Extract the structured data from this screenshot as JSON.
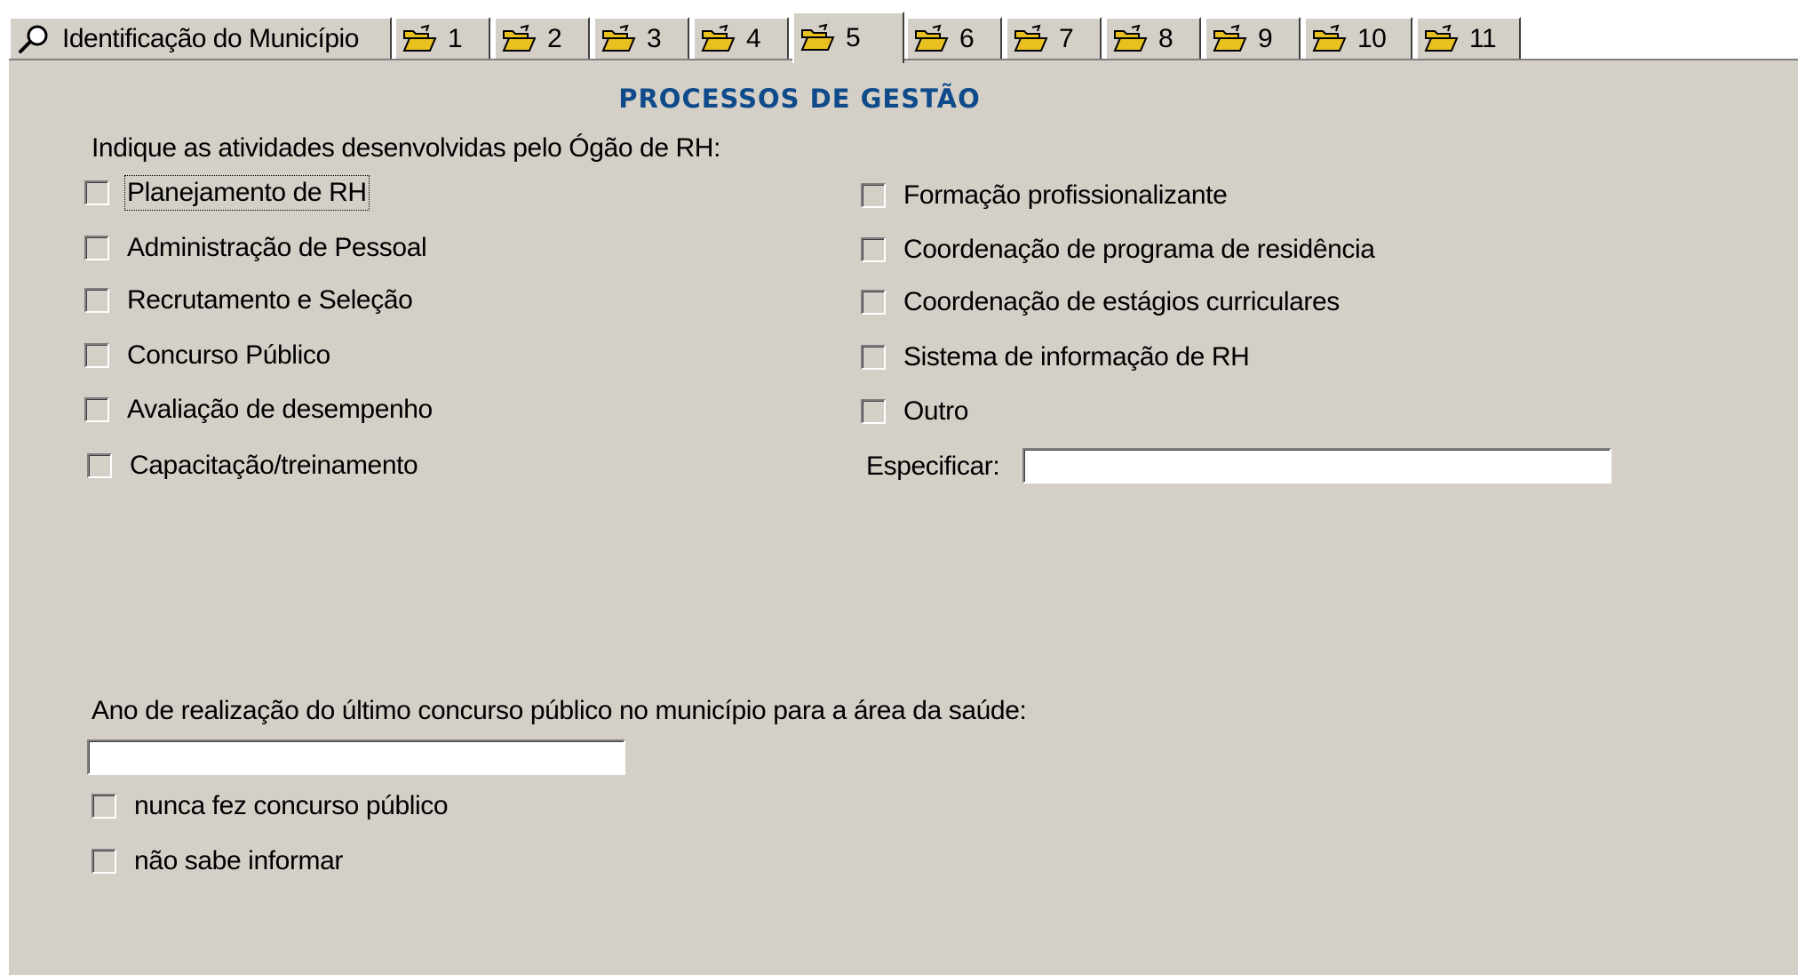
{
  "tabs": [
    {
      "label": "Identificação do Município",
      "icon": "search-icon"
    },
    {
      "label": "1",
      "icon": "open-folder-icon"
    },
    {
      "label": "2",
      "icon": "open-folder-icon"
    },
    {
      "label": "3",
      "icon": "open-folder-icon"
    },
    {
      "label": "4",
      "icon": "open-folder-icon"
    },
    {
      "label": "5",
      "icon": "open-folder-icon",
      "active": true
    },
    {
      "label": "6",
      "icon": "open-folder-icon"
    },
    {
      "label": "7",
      "icon": "open-folder-icon"
    },
    {
      "label": "8",
      "icon": "open-folder-icon"
    },
    {
      "label": "9",
      "icon": "open-folder-icon"
    },
    {
      "label": "10",
      "icon": "open-folder-icon"
    },
    {
      "label": "11",
      "icon": "open-folder-icon"
    }
  ],
  "section": {
    "title": "PROCESSOS DE GESTÃO",
    "instruction": "Indique as atividades desenvolvidas pelo Ógão de RH:"
  },
  "activities_left": [
    {
      "label": "Planejamento de RH",
      "checked": false
    },
    {
      "label": "Administração de Pessoal",
      "checked": false
    },
    {
      "label": "Recrutamento e Seleção",
      "checked": false
    },
    {
      "label": "Concurso Público",
      "checked": false
    },
    {
      "label": "Avaliação de desempenho",
      "checked": false
    },
    {
      "label": "Capacitação/treinamento",
      "checked": false
    }
  ],
  "activities_right": [
    {
      "label": "Formação profissionalizante",
      "checked": false
    },
    {
      "label": "Coordenação de programa de residência",
      "checked": false
    },
    {
      "label": "Coordenação de estágios curriculares",
      "checked": false
    },
    {
      "label": "Sistema de informação de RH",
      "checked": false
    },
    {
      "label": "Outro",
      "checked": false
    }
  ],
  "specify": {
    "label": "Especificar:",
    "value": ""
  },
  "contest": {
    "question": "Ano de realização do último concurso público no município para a área da saúde:",
    "year_value": "",
    "never_label": "nunca fez concurso público",
    "unknown_label": "não sabe informar"
  },
  "colors": {
    "panel_bg": "#d4d0c8",
    "title": "#0f4a8a",
    "folder": "#e8c020"
  }
}
